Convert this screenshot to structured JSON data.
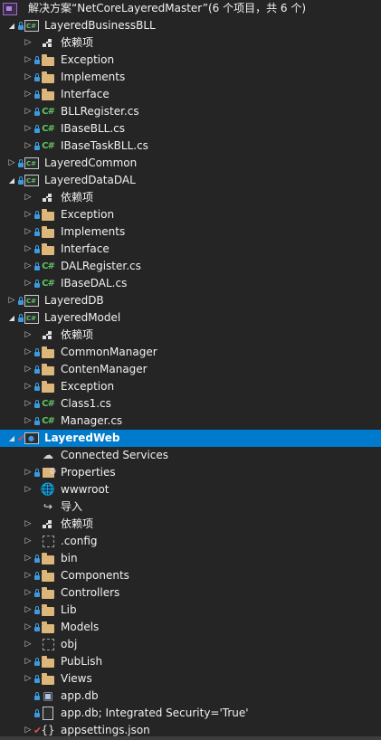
{
  "solution": {
    "label": "解决方案“NetCoreLayeredMaster”(6 个项目，共 6 个)"
  },
  "rows": [
    {
      "label": "LayeredBusinessBLL",
      "icon": "csharp-project-icon",
      "arrow": "expanded",
      "lock": true,
      "level": 1
    },
    {
      "label": "依赖项",
      "icon": "dependencies-icon",
      "arrow": "collapsed",
      "lock": false,
      "level": 2
    },
    {
      "label": "Exception",
      "icon": "folder-icon",
      "arrow": "collapsed",
      "lock": true,
      "level": 2
    },
    {
      "label": "Implements",
      "icon": "folder-icon",
      "arrow": "collapsed",
      "lock": true,
      "level": 2
    },
    {
      "label": "Interface",
      "icon": "folder-icon",
      "arrow": "collapsed",
      "lock": true,
      "level": 2
    },
    {
      "label": "BLLRegister.cs",
      "icon": "csharp-file-icon",
      "arrow": "collapsed",
      "lock": true,
      "level": 2
    },
    {
      "label": "IBaseBLL.cs",
      "icon": "csharp-file-icon",
      "arrow": "collapsed",
      "lock": true,
      "level": 2
    },
    {
      "label": "IBaseTaskBLL.cs",
      "icon": "csharp-file-icon",
      "arrow": "collapsed",
      "lock": true,
      "level": 2
    },
    {
      "label": "LayeredCommon",
      "icon": "csharp-project-icon",
      "arrow": "collapsed",
      "lock": true,
      "level": 1
    },
    {
      "label": "LayeredDataDAL",
      "icon": "csharp-project-icon",
      "arrow": "expanded",
      "lock": true,
      "level": 1
    },
    {
      "label": "依赖项",
      "icon": "dependencies-icon",
      "arrow": "collapsed",
      "lock": false,
      "level": 2
    },
    {
      "label": "Exception",
      "icon": "folder-icon",
      "arrow": "collapsed",
      "lock": true,
      "level": 2
    },
    {
      "label": "Implements",
      "icon": "folder-icon",
      "arrow": "collapsed",
      "lock": true,
      "level": 2
    },
    {
      "label": "Interface",
      "icon": "folder-icon",
      "arrow": "collapsed",
      "lock": true,
      "level": 2
    },
    {
      "label": "DALRegister.cs",
      "icon": "csharp-file-icon",
      "arrow": "collapsed",
      "lock": true,
      "level": 2
    },
    {
      "label": "IBaseDAL.cs",
      "icon": "csharp-file-icon",
      "arrow": "collapsed",
      "lock": true,
      "level": 2
    },
    {
      "label": "LayeredDB",
      "icon": "csharp-project-icon",
      "arrow": "collapsed",
      "lock": true,
      "level": 1
    },
    {
      "label": "LayeredModel",
      "icon": "csharp-project-icon",
      "arrow": "expanded",
      "lock": true,
      "level": 1
    },
    {
      "label": "依赖项",
      "icon": "dependencies-icon",
      "arrow": "collapsed",
      "lock": false,
      "level": 2
    },
    {
      "label": "CommonManager",
      "icon": "folder-icon",
      "arrow": "collapsed",
      "lock": true,
      "level": 2
    },
    {
      "label": "ContenManager",
      "icon": "folder-icon",
      "arrow": "collapsed",
      "lock": true,
      "level": 2
    },
    {
      "label": "Exception",
      "icon": "folder-icon",
      "arrow": "collapsed",
      "lock": true,
      "level": 2
    },
    {
      "label": "Class1.cs",
      "icon": "csharp-file-icon",
      "arrow": "collapsed",
      "lock": true,
      "level": 2
    },
    {
      "label": "Manager.cs",
      "icon": "csharp-file-icon",
      "arrow": "collapsed",
      "lock": true,
      "level": 2
    },
    {
      "label": "LayeredWeb",
      "icon": "web-project-icon",
      "arrow": "expanded",
      "lock": false,
      "check": true,
      "level": 1,
      "selected": true
    },
    {
      "label": "Connected Services",
      "icon": "connected-services-icon",
      "arrow": "none",
      "lock": false,
      "level": 2
    },
    {
      "label": "Properties",
      "icon": "properties-icon",
      "arrow": "collapsed",
      "lock": true,
      "level": 2
    },
    {
      "label": "wwwroot",
      "icon": "globe-icon",
      "arrow": "collapsed",
      "lock": false,
      "level": 2
    },
    {
      "label": "导入",
      "icon": "import-icon",
      "arrow": "none",
      "lock": false,
      "level": 2
    },
    {
      "label": "依赖项",
      "icon": "dependencies-icon",
      "arrow": "collapsed",
      "lock": false,
      "level": 2
    },
    {
      "label": ".config",
      "icon": "hidden-folder-icon",
      "arrow": "collapsed",
      "lock": false,
      "level": 2
    },
    {
      "label": "bin",
      "icon": "folder-icon",
      "arrow": "collapsed",
      "lock": true,
      "level": 2
    },
    {
      "label": "Components",
      "icon": "folder-icon",
      "arrow": "collapsed",
      "lock": true,
      "level": 2
    },
    {
      "label": "Controllers",
      "icon": "folder-icon",
      "arrow": "collapsed",
      "lock": true,
      "level": 2
    },
    {
      "label": "Lib",
      "icon": "folder-icon",
      "arrow": "collapsed",
      "lock": true,
      "level": 2
    },
    {
      "label": "Models",
      "icon": "folder-icon",
      "arrow": "collapsed",
      "lock": true,
      "level": 2
    },
    {
      "label": "obj",
      "icon": "hidden-folder-icon",
      "arrow": "collapsed",
      "lock": false,
      "level": 2
    },
    {
      "label": "PubLish",
      "icon": "folder-icon",
      "arrow": "collapsed",
      "lock": true,
      "level": 2
    },
    {
      "label": "Views",
      "icon": "folder-icon",
      "arrow": "collapsed",
      "lock": true,
      "level": 2
    },
    {
      "label": "app.db",
      "icon": "database-file-icon",
      "arrow": "none",
      "lock": true,
      "level": 2
    },
    {
      "label": "app.db; Integrated Security='True'",
      "icon": "file-icon",
      "arrow": "none",
      "lock": true,
      "level": 2
    },
    {
      "label": "appsettings.json",
      "icon": "json-file-icon",
      "arrow": "collapsed",
      "lock": false,
      "check": true,
      "level": 2
    }
  ]
}
